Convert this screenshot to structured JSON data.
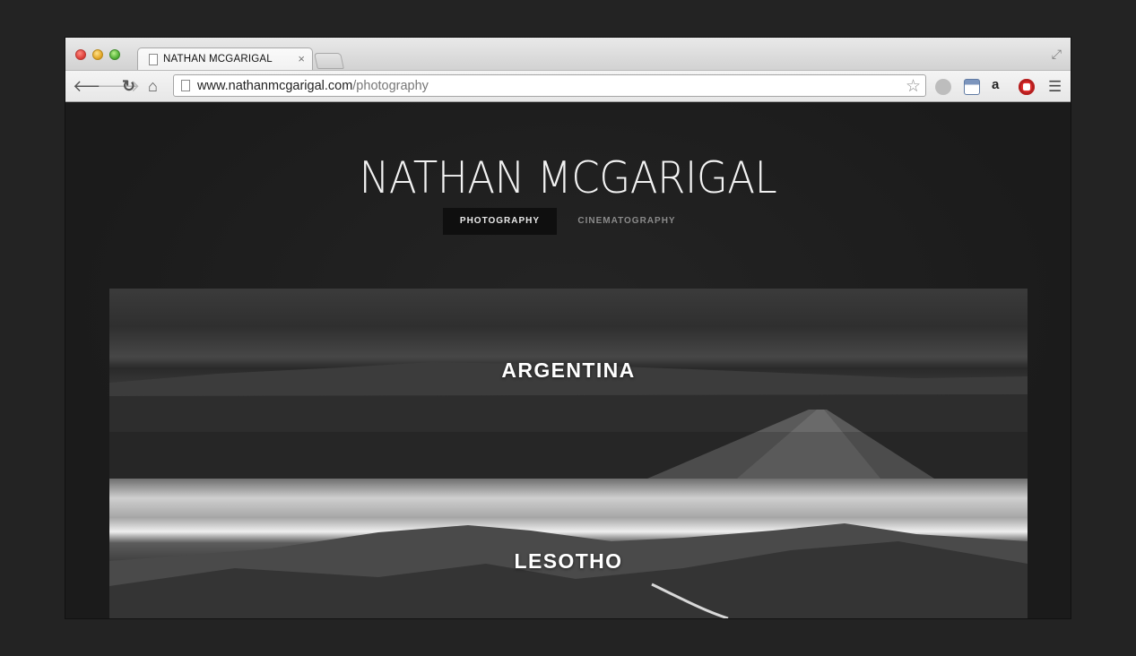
{
  "browser": {
    "tab_title": "NATHAN MCGARIGAL",
    "tab_close": "×",
    "url_host": "www.nathanmcgarigal.com",
    "url_path": "/photography",
    "icons": {
      "back": "back-arrow-icon",
      "forward": "forward-arrow-icon",
      "reload": "reload-icon",
      "home": "home-icon",
      "bookmark": "star-icon",
      "menu": "hamburger-menu-icon",
      "fullscreen": "fullscreen-icon"
    },
    "extension_amazon_glyph": "a"
  },
  "site": {
    "title": "NATHAN MCGARIGAL",
    "nav": [
      {
        "label": "PHOTOGRAPHY",
        "active": true
      },
      {
        "label": "CINEMATOGRAPHY",
        "active": false
      }
    ]
  },
  "gallery": [
    {
      "label": "ARGENTINA"
    },
    {
      "label": "LESOTHO"
    }
  ],
  "colors": {
    "background": "#232323",
    "page": "#1c1c1c",
    "active_nav": "#0f0f0f",
    "title_text": "#f2f2f2",
    "inactive_nav_text": "#8a8a8a"
  }
}
